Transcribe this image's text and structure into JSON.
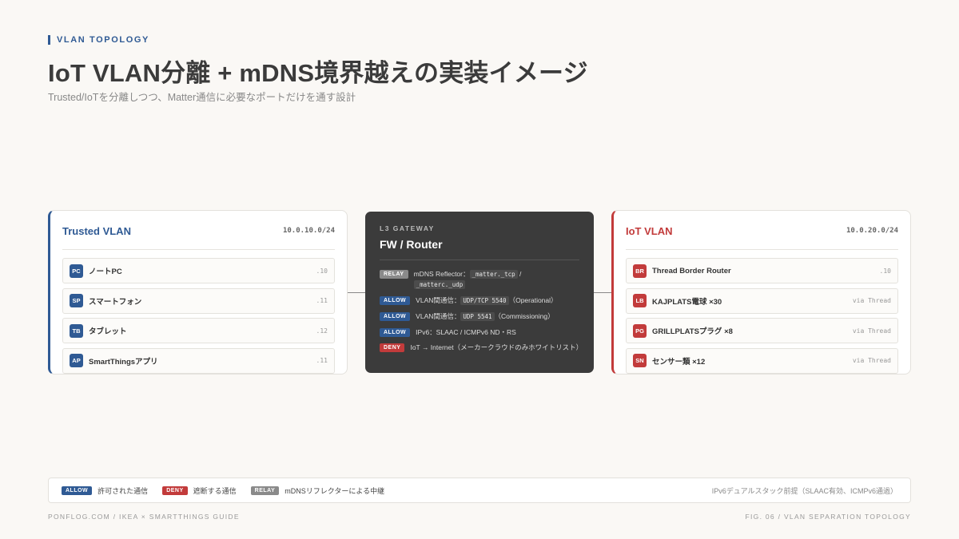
{
  "header": {
    "eyebrow": "VLAN TOPOLOGY",
    "title": "IoT VLAN分離 + mDNS境界越えの実装イメージ",
    "subtitle": "Trusted/IoTを分離しつつ、Matter通信に必要なポートだけを通す設計"
  },
  "trusted": {
    "title": "Trusted VLAN",
    "cidr": "10.0.10.0/24",
    "devices": [
      {
        "badge": "PC",
        "name": "ノートPC",
        "meta": ".10"
      },
      {
        "badge": "SP",
        "name": "スマートフォン",
        "meta": ".11"
      },
      {
        "badge": "TB",
        "name": "タブレット",
        "meta": ".12"
      },
      {
        "badge": "AP",
        "name": "SmartThingsアプリ",
        "meta": ".11"
      }
    ]
  },
  "gateway": {
    "eyebrow": "L3 GATEWAY",
    "title": "FW / Router",
    "rules": [
      {
        "tag": "RELAY",
        "pre": "mDNS Reflector：",
        "code1": "_matter._tcp",
        "mid": " / ",
        "code2": "_matterc._udp",
        "post": ""
      },
      {
        "tag": "ALLOW",
        "pre": "VLAN間通信：",
        "code1": "UDP/TCP 5540",
        "mid": "",
        "code2": "",
        "post": "（Operational）"
      },
      {
        "tag": "ALLOW",
        "pre": "VLAN間通信：",
        "code1": "UDP 5541",
        "mid": "",
        "code2": "",
        "post": "（Commissioning）"
      },
      {
        "tag": "ALLOW",
        "pre": "IPv6：SLAAC / ICMPv6 ND・RS",
        "code1": "",
        "mid": "",
        "code2": "",
        "post": ""
      },
      {
        "tag": "DENY",
        "pre": "IoT → Internet（メーカークラウドのみホワイトリスト）",
        "code1": "",
        "mid": "",
        "code2": "",
        "post": ""
      }
    ]
  },
  "iot": {
    "title": "IoT VLAN",
    "cidr": "10.0.20.0/24",
    "devices": [
      {
        "badge": "BR",
        "name": "Thread Border Router",
        "meta": ".10"
      },
      {
        "badge": "LB",
        "name": "KAJPLATS電球 ×30",
        "meta": "via Thread"
      },
      {
        "badge": "PG",
        "name": "GRILLPLATSプラグ ×8",
        "meta": "via Thread"
      },
      {
        "badge": "SN",
        "name": "センサー類 ×12",
        "meta": "via Thread"
      }
    ]
  },
  "legend": {
    "allow_tag": "ALLOW",
    "allow_label": "許可された通信",
    "deny_tag": "DENY",
    "deny_label": "遮断する通信",
    "relay_tag": "RELAY",
    "relay_label": "mDNSリフレクターによる中継",
    "note": "IPv6デュアルスタック前提（SLAAC有効、ICMPv6通過）"
  },
  "footer": {
    "left": "PONFLOG.COM / IKEA × SMARTTHINGS GUIDE",
    "right": "FIG. 06 / VLAN SEPARATION TOPOLOGY"
  }
}
